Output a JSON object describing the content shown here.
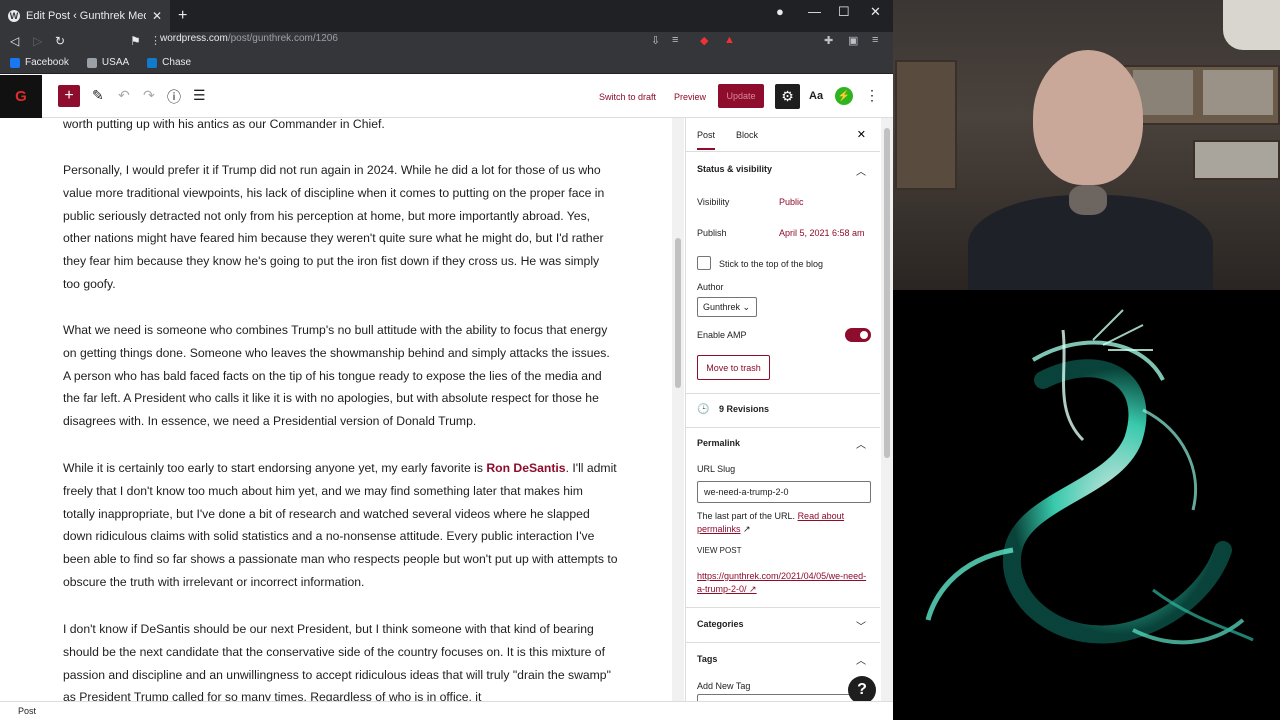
{
  "browser": {
    "tab_title": "Edit Post ‹ Gunthrek Media — W",
    "url_domain": "wordpress.com",
    "url_path": "/post/gunthrek.com/1206",
    "bookmarks": [
      {
        "label": "Facebook",
        "color": "#1877f2"
      },
      {
        "label": "USAA",
        "color": "#9aa0a6"
      },
      {
        "label": "Chase",
        "color": "#117aca"
      }
    ]
  },
  "editor": {
    "logo": "G",
    "switch_to_draft": "Switch to draft",
    "preview": "Preview",
    "update": "Update",
    "aa": "Aa"
  },
  "content": {
    "p0": "worth putting up with his antics as our Commander in Chief.",
    "p1": "Personally, I would prefer it if Trump did not run again in 2024.  While he did a lot for those of us who value more traditional viewpoints, his lack of discipline when it comes to putting on the proper face in public seriously detracted not only from his perception at home, but more importantly abroad.  Yes, other nations might have feared him because they weren't quite sure what he might do, but I'd rather they fear him because they know he's going to put the iron fist down if they cross us.  He was simply too goofy.",
    "p2": "What we need is someone who combines Trump's no bull attitude with the ability to focus that energy on getting things done.  Someone who leaves the showmanship behind and simply attacks the issues.  A person who has bald faced facts on the tip of his tongue ready to expose the lies of the media and the far left.  A President who calls it like it is with no apologies, but with absolute respect for those he disagrees with.  In essence, we need a Presidential version of Donald Trump.",
    "p3_before": "While it is certainly too early to start endorsing anyone yet, my early favorite is ",
    "p3_link": "Ron DeSantis",
    "p3_after": ".  I'll admit freely that I don't know too much about him yet, and we may find something later that makes him totally inappropriate, but I've done a bit of research and watched several videos where he slapped down ridiculous claims with solid statistics and a no-nonsense attitude.  Every public interaction I've been able to find so far shows a passionate man who respects people but won't put up with attempts to obscure the truth with irrelevant or incorrect information.",
    "p4": "I don't know if DeSantis should be our next President, but I think someone with that kind of bearing should be the next candidate that the conservative side of the country focuses on.  It is this mixture of passion and discipline and an unwillingness to accept ridiculous ideas that will truly \"drain the swamp\" as President Trump called for so many times.  Regardless of who is in office, it"
  },
  "sidebar": {
    "tab_post": "Post",
    "tab_block": "Block",
    "status_title": "Status & visibility",
    "visibility_label": "Visibility",
    "visibility_value": "Public",
    "publish_label": "Publish",
    "publish_value": "April 5, 2021 6:58 am",
    "sticky_label": "Stick to the top of the blog",
    "author_label": "Author",
    "author_value": "Gunthrek",
    "amp_label": "Enable AMP",
    "trash_label": "Move to trash",
    "revisions": "9 Revisions",
    "permalink_title": "Permalink",
    "slug_label": "URL Slug",
    "slug_value": "we-need-a-trump-2-0",
    "slug_help": "The last part of the URL.",
    "slug_help_link": "Read about permalinks",
    "view_post_label": "VIEW POST",
    "view_post_url": "https://gunthrek.com/2021/04/05/we-need-a-trump-2-0/",
    "categories_title": "Categories",
    "tags_title": "Tags",
    "add_tag_label": "Add New Tag"
  },
  "footer": {
    "breadcrumb": "Post"
  },
  "colors": {
    "accent": "#8e0c2c",
    "chrome_dark": "#35363a"
  }
}
